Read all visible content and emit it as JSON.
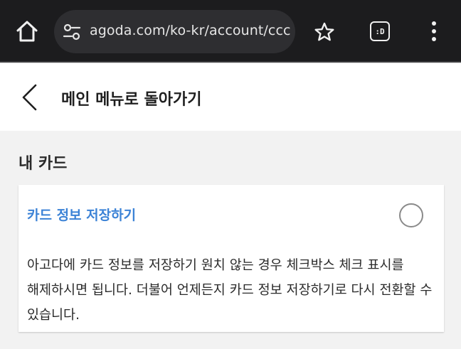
{
  "browser": {
    "url": "agoda.com/ko-kr/account/ccc",
    "tabs_label": ":D",
    "icons": {
      "home": "home-icon",
      "site_settings": "tune-icon",
      "bookmark": "star-icon",
      "tabs": "tab-switcher-icon",
      "menu": "more-vert-icon"
    }
  },
  "header": {
    "back_icon": "chevron-left-icon",
    "title": "메인 메뉴로 돌아가기"
  },
  "section": {
    "title": "내 카드"
  },
  "card": {
    "option_label": "카드 정보 저장하기",
    "checkbox_checked": false,
    "description": "아고다에 카드 정보를 저장하기 원치 않는 경우 체크박스 체크 표시를 해제하시면 됩니다. 더불어 언제든지 카드 정보 저장하기로 다시 전환할 수 있습니다."
  },
  "colors": {
    "accent": "#3b82d6",
    "chrome_bg": "#1c1c1e",
    "page_bg": "#f2f2f2"
  }
}
